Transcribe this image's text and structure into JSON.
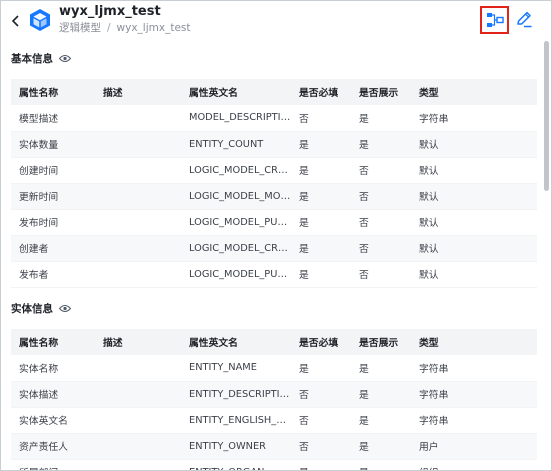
{
  "header": {
    "title": "wyx_ljmx_test",
    "breadcrumb_parent": "逻辑模型",
    "breadcrumb_separator": "/",
    "breadcrumb_current": "wyx_ljmx_test",
    "icons": {
      "back": "chevron-left-icon",
      "logo": "cube-icon",
      "graph": "diagram-icon",
      "edit": "pencil-icon"
    },
    "accent_color": "#1677ff",
    "highlight_color": "#e2231a"
  },
  "sections": [
    {
      "title": "基本信息",
      "icon": "eye-icon",
      "columns": [
        "属性名称",
        "描述",
        "属性英文名",
        "是否必填",
        "是否展示",
        "类型"
      ],
      "rows": [
        [
          "模型描述",
          "",
          "MODEL_DESCRIPTION",
          "否",
          "是",
          "字符串"
        ],
        [
          "实体数量",
          "",
          "ENTITY_COUNT",
          "是",
          "是",
          "默认"
        ],
        [
          "创建时间",
          "",
          "LOGIC_MODEL_CREA...",
          "是",
          "否",
          "默认"
        ],
        [
          "更新时间",
          "",
          "LOGIC_MODEL_MOD...",
          "是",
          "否",
          "默认"
        ],
        [
          "发布时间",
          "",
          "LOGIC_MODEL_PUBL...",
          "是",
          "否",
          "默认"
        ],
        [
          "创建者",
          "",
          "LOGIC_MODEL_CREA...",
          "是",
          "否",
          "默认"
        ],
        [
          "发布者",
          "",
          "LOGIC_MODEL_PUBL...",
          "是",
          "否",
          "默认"
        ]
      ]
    },
    {
      "title": "实体信息",
      "icon": "eye-icon",
      "columns": [
        "属性名称",
        "描述",
        "属性英文名",
        "是否必填",
        "是否展示",
        "类型"
      ],
      "rows": [
        [
          "实体名称",
          "",
          "ENTITY_NAME",
          "是",
          "是",
          "字符串"
        ],
        [
          "实体描述",
          "",
          "ENTITY_DESCRIPTION",
          "否",
          "是",
          "字符串"
        ],
        [
          "实体英文名",
          "",
          "ENTITY_ENGLISH_NA...",
          "否",
          "是",
          "字符串"
        ],
        [
          "资产责任人",
          "",
          "ENTITY_OWNER",
          "否",
          "是",
          "用户"
        ],
        [
          "所属部门",
          "",
          "ENTITY_ORGAN...",
          "是",
          "是",
          "组织"
        ]
      ]
    }
  ]
}
